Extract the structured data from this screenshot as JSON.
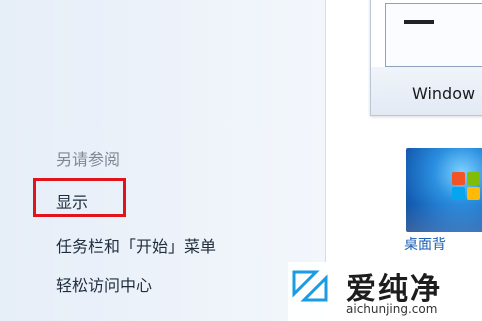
{
  "see_also": {
    "heading": "另请参阅",
    "links": [
      {
        "label": "显示"
      },
      {
        "label": "任务栏和「开始」菜单"
      },
      {
        "label": "轻松访问中心"
      }
    ]
  },
  "theme_thumbnail": {
    "caption": "Window"
  },
  "desktop_background": {
    "caption": "桌面背"
  },
  "watermark": {
    "name": "爱纯净",
    "url": "aichunjing.com"
  },
  "colors": {
    "highlight": "#e0141c",
    "link_text": "#1f2d3d",
    "heading_text": "#7f8794",
    "pane_bg": "#e6eef8"
  }
}
